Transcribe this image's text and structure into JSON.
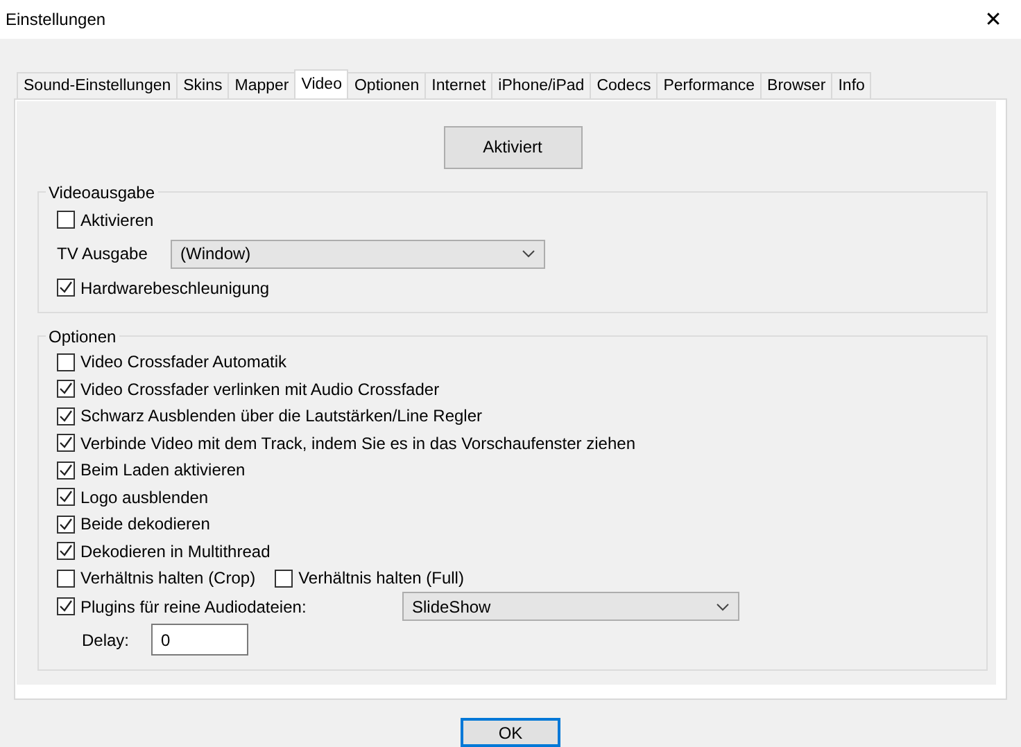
{
  "window": {
    "title": "Einstellungen",
    "close": "✕"
  },
  "tabs": [
    {
      "label": "Sound-Einstellungen",
      "selected": false
    },
    {
      "label": "Skins",
      "selected": false
    },
    {
      "label": "Mapper",
      "selected": false
    },
    {
      "label": "Video",
      "selected": true
    },
    {
      "label": "Optionen",
      "selected": false
    },
    {
      "label": "Internet",
      "selected": false
    },
    {
      "label": "iPhone/iPad",
      "selected": false
    },
    {
      "label": "Codecs",
      "selected": false
    },
    {
      "label": "Performance",
      "selected": false
    },
    {
      "label": "Browser",
      "selected": false
    },
    {
      "label": "Info",
      "selected": false
    }
  ],
  "activate_button": "Aktiviert",
  "video_output": {
    "title": "Videoausgabe",
    "activate": {
      "label": "Aktivieren",
      "checked": false
    },
    "tv_output": {
      "label": "TV Ausgabe",
      "value": "(Window)"
    },
    "hardware": {
      "label": "Hardwarebeschleunigung",
      "checked": true
    }
  },
  "options": {
    "title": "Optionen",
    "items": [
      {
        "kind": "checkbox",
        "label": "Video Crossfader Automatik",
        "checked": false
      },
      {
        "kind": "checkbox",
        "label": "Video Crossfader verlinken mit Audio Crossfader",
        "checked": true
      },
      {
        "kind": "checkbox",
        "label": "Schwarz Ausblenden über die Lautstärken/Line Regler",
        "checked": true
      },
      {
        "kind": "checkbox",
        "label": "Verbinde Video mit dem Track, indem Sie es in das Vorschaufenster ziehen",
        "checked": true
      },
      {
        "kind": "checkbox",
        "label": "Beim Laden aktivieren",
        "checked": true
      },
      {
        "kind": "checkbox",
        "label": "Logo ausblenden",
        "checked": true
      },
      {
        "kind": "checkbox",
        "label": "Beide dekodieren",
        "checked": true
      },
      {
        "kind": "checkbox",
        "label": "Dekodieren in Multithread",
        "checked": true
      },
      {
        "kind": "pair",
        "boxes": [
          {
            "label": "Verhältnis halten (Crop)",
            "checked": false
          },
          {
            "label": "Verhältnis halten (Full)",
            "checked": false
          }
        ]
      },
      {
        "kind": "select",
        "label": "Plugins für reine Audiodateien:",
        "checked": true,
        "value": "SlideShow"
      }
    ],
    "delay": {
      "label": "Delay:",
      "value": "0"
    }
  },
  "ok_button": "OK"
}
